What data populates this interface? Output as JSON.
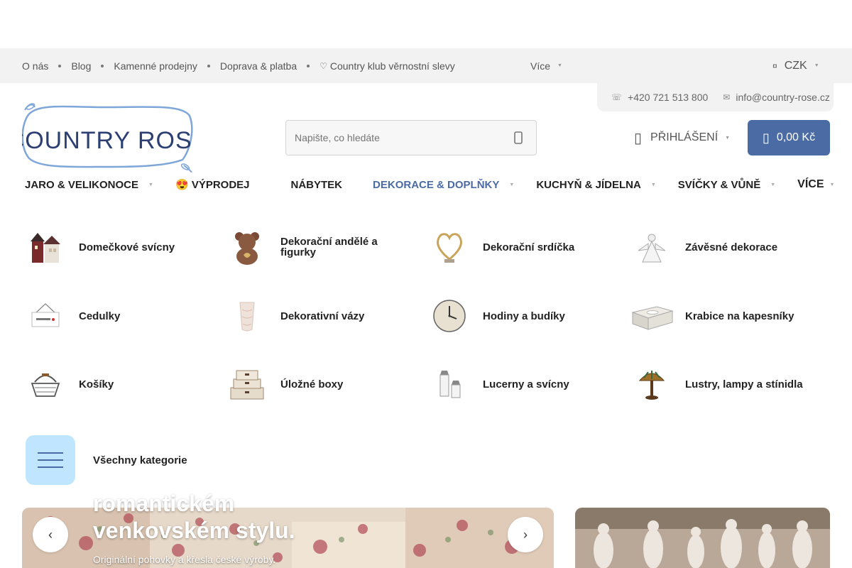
{
  "topbar": {
    "links": [
      "O nás",
      "Blog",
      "Kamenné prodejny",
      "Doprava & platba",
      "Country klub věrnostní slevy"
    ],
    "more_label": "Více",
    "currency": "CZK"
  },
  "contact": {
    "phone": "+420 721 513 800",
    "email": "info@country-rose.cz"
  },
  "logo": {
    "text": "COUNTRY ROSE"
  },
  "search": {
    "placeholder": "Napište, co hledáte"
  },
  "header": {
    "login_label": "PŘIHLÁŠENÍ",
    "cart_total": "0,00 Kč"
  },
  "mainnav": {
    "items": [
      "JARO & VELIKONOCE",
      "😍 VÝPRODEJ",
      "NÁBYTEK",
      "DEKORACE & DOPLŇKY",
      "KUCHYŇ & JÍDELNA",
      "SVÍČKY & VŮNĚ",
      "VÍCE"
    ]
  },
  "categories": [
    "Domečkové svícny",
    "Dekorační andělé a figurky",
    "Dekorační srdíčka",
    "Závěsné dekorace",
    "Cedulky",
    "Dekorativní vázy",
    "Hodiny a budíky",
    "Krabice na kapesníky",
    "Košíky",
    "Úložné boxy",
    "Lucerny a svícny",
    "Lustry, lampy a stínidla"
  ],
  "all_categories_label": "Všechny kategorie",
  "banner": {
    "heading_line1": "romantickém",
    "heading_line2": "venkovském stylu.",
    "subtitle": "Originální pohovky a křesla české výroby."
  },
  "colors": {
    "accent": "#4a6ba4",
    "topbar_bg": "#f2f2f2",
    "all_btn_bg": "#bfe5ff"
  }
}
